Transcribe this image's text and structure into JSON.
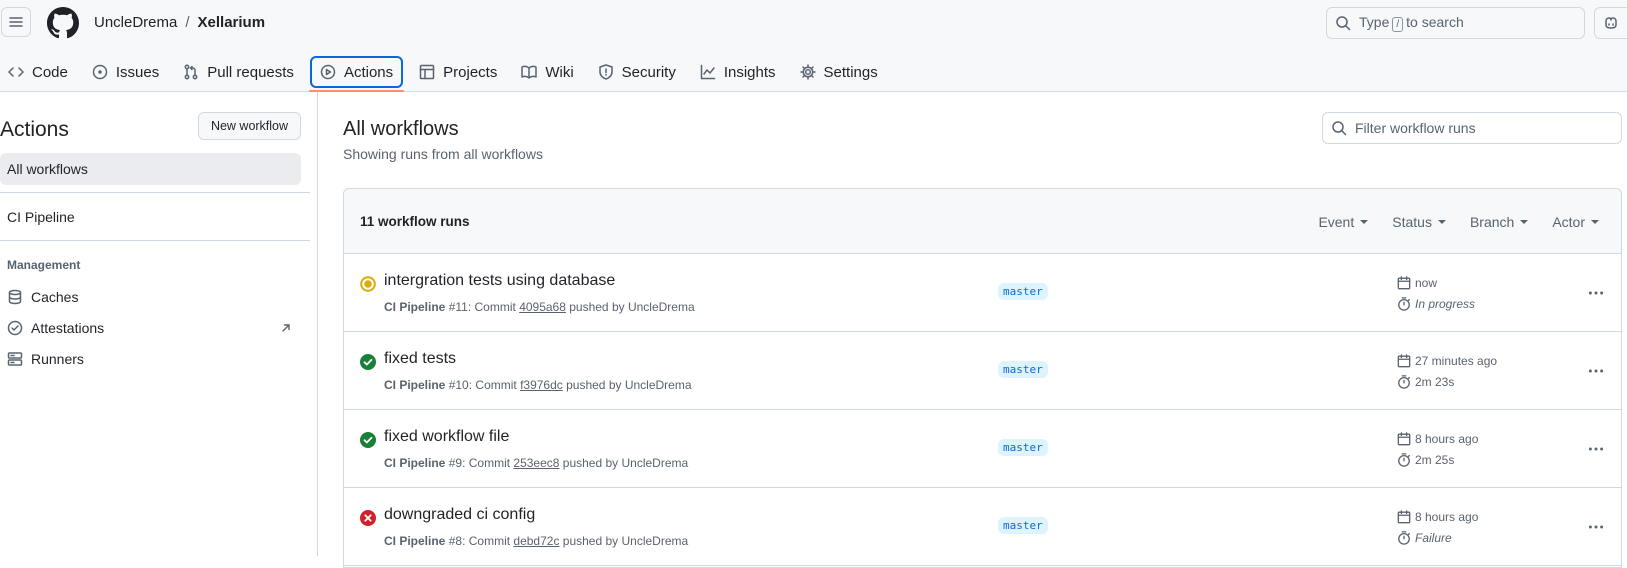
{
  "header": {
    "owner": "UncleDrema",
    "separator": "/",
    "repo": "Xellarium",
    "search_prefix": "Type",
    "search_key": "/",
    "search_suffix": "to search"
  },
  "tabs": [
    {
      "label": "Code",
      "icon": "code-icon"
    },
    {
      "label": "Issues",
      "icon": "issue-icon"
    },
    {
      "label": "Pull requests",
      "icon": "pull-request-icon"
    },
    {
      "label": "Actions",
      "icon": "play-icon",
      "active": true
    },
    {
      "label": "Projects",
      "icon": "table-icon"
    },
    {
      "label": "Wiki",
      "icon": "book-icon"
    },
    {
      "label": "Security",
      "icon": "shield-icon"
    },
    {
      "label": "Insights",
      "icon": "graph-icon"
    },
    {
      "label": "Settings",
      "icon": "gear-icon"
    }
  ],
  "sidebar": {
    "title": "Actions",
    "new_workflow": "New workflow",
    "all_workflows": "All workflows",
    "workflow": "CI Pipeline",
    "section": "Management",
    "management": [
      {
        "label": "Caches",
        "icon": "database-icon"
      },
      {
        "label": "Attestations",
        "icon": "verified-icon"
      },
      {
        "label": "Runners",
        "icon": "server-icon"
      }
    ]
  },
  "main": {
    "title": "All workflows",
    "subtitle": "Showing runs from all workflows",
    "filter_placeholder": "Filter workflow runs",
    "runs_count": "11 workflow runs",
    "filters": [
      "Event",
      "Status",
      "Branch",
      "Actor"
    ]
  },
  "runs": [
    {
      "title": "intergration tests using database",
      "workflow": "CI Pipeline",
      "number": "#11",
      "commit": "4095a68",
      "actor": "UncleDrema",
      "branch": "master",
      "when": "now",
      "duration": "In progress",
      "status": "in-progress",
      "italic": true
    },
    {
      "title": "fixed tests",
      "workflow": "CI Pipeline",
      "number": "#10",
      "commit": "f3976dc",
      "actor": "UncleDrema",
      "branch": "master",
      "when": "27 minutes ago",
      "duration": "2m 23s",
      "status": "success",
      "italic": false
    },
    {
      "title": "fixed workflow file",
      "workflow": "CI Pipeline",
      "number": "#9",
      "commit": "253eec8",
      "actor": "UncleDrema",
      "branch": "master",
      "when": "8 hours ago",
      "duration": "2m 25s",
      "status": "success",
      "italic": false
    },
    {
      "title": "downgraded ci config",
      "workflow": "CI Pipeline",
      "number": "#8",
      "commit": "debd72c",
      "actor": "UncleDrema",
      "branch": "master",
      "when": "8 hours ago",
      "duration": "Failure",
      "status": "failure",
      "italic": true
    }
  ],
  "colors": {
    "accent": "#0969da",
    "success": "#1a7f37",
    "failure": "#cf222e",
    "in_progress": "#dbab09",
    "active_underline": "#fd8c73"
  }
}
